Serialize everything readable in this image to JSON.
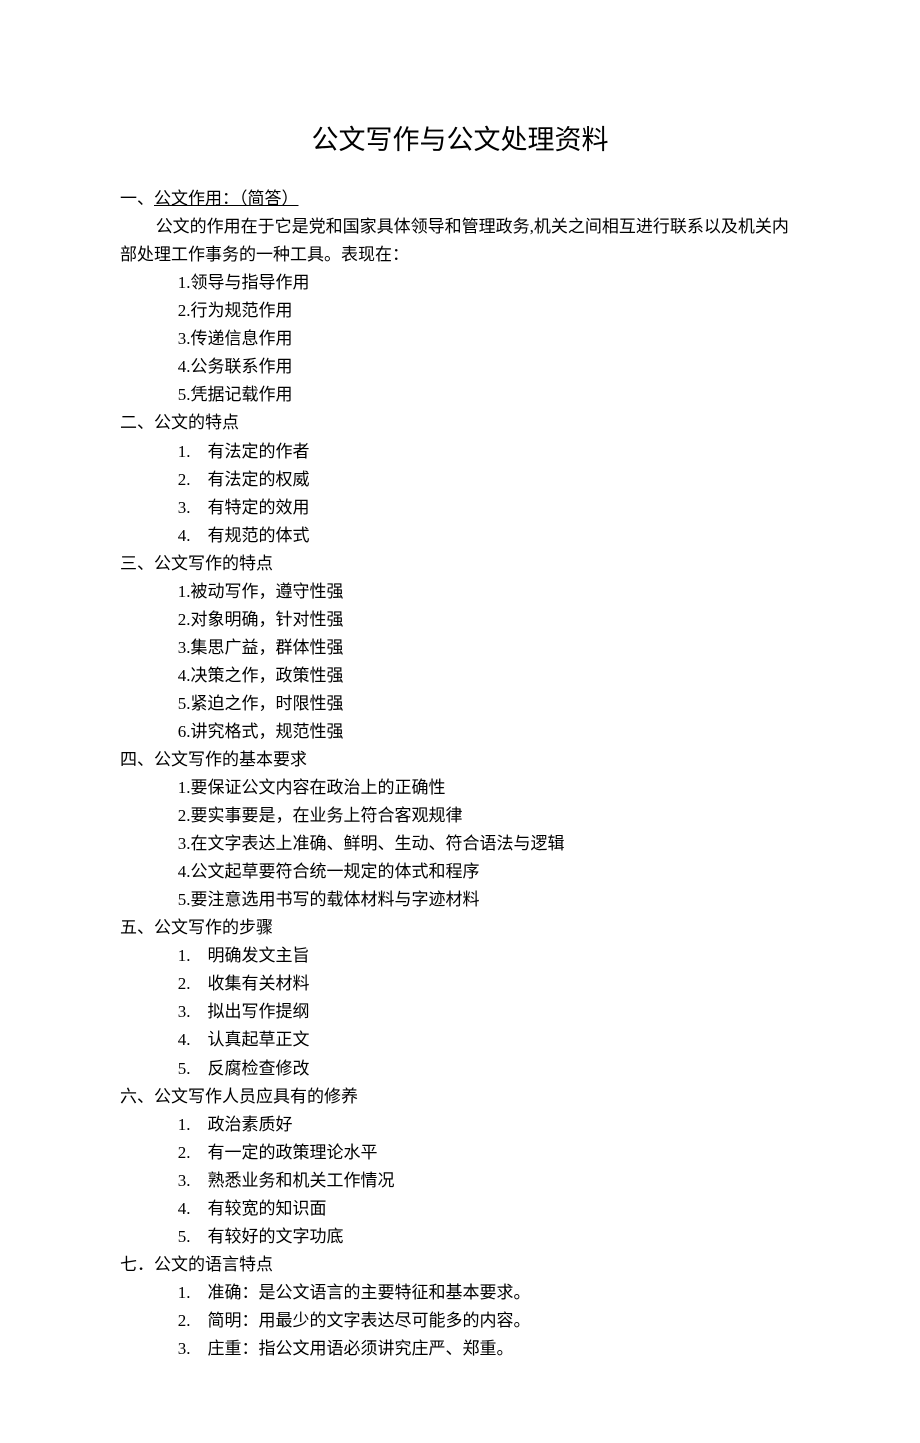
{
  "title": "公文写作与公文处理资料",
  "sections": [
    {
      "heading": "一、",
      "heading_rest": "公文作用：（简答）",
      "underlined": true,
      "intro": "公文的作用在于它是党和国家具体领导和管理政务,机关之间相互进行联系以及机关内部处理工作事务的一种工具。表现在：",
      "items": [
        "1.领导与指导作用",
        "2.行为规范作用",
        "3.传递信息作用",
        "4.公务联系作用",
        "5.凭据记载作用"
      ],
      "spaced": false
    },
    {
      "heading": "二、公文的特点",
      "underlined": false,
      "items": [
        "1.　有法定的作者",
        "2.　有法定的权威",
        "3.　有特定的效用",
        "4.　有规范的体式"
      ],
      "spaced": true
    },
    {
      "heading": "三、公文写作的特点",
      "underlined": false,
      "items": [
        "1.被动写作，遵守性强",
        " 2.对象明确，针对性强",
        "3.集思广益，群体性强",
        "4.决策之作，政策性强",
        "5.紧迫之作，时限性强",
        "6.讲究格式，规范性强"
      ],
      "spaced": false
    },
    {
      "heading": "四、公文写作的基本要求",
      "underlined": false,
      "items": [
        "1.要保证公文内容在政治上的正确性",
        "2.要实事要是，在业务上符合客观规律",
        "3.在文字表达上准确、鲜明、生动、符合语法与逻辑",
        "4.公文起草要符合统一规定的体式和程序",
        "5.要注意选用书写的载体材料与字迹材料"
      ],
      "spaced": false
    },
    {
      "heading": "五、公文写作的步骤",
      "underlined": false,
      "items": [
        "1.　明确发文主旨",
        "2.　收集有关材料",
        "3.　拟出写作提纲",
        "4.　认真起草正文",
        "5.　反腐检查修改"
      ],
      "spaced": true
    },
    {
      "heading": "六、公文写作人员应具有的修养",
      "underlined": false,
      "items": [
        "1.　政治素质好",
        "2.　有一定的政策理论水平",
        "3.　熟悉业务和机关工作情况",
        "4.　有较宽的知识面",
        "5.　有较好的文字功底"
      ],
      "spaced": true
    },
    {
      "heading": "七．公文的语言特点",
      "underlined": false,
      "items": [
        "1.　准确：是公文语言的主要特征和基本要求。",
        "2.　简明：用最少的文字表达尽可能多的内容。",
        "3.　庄重：指公文用语必须讲究庄严、郑重。"
      ],
      "spaced": true
    }
  ]
}
